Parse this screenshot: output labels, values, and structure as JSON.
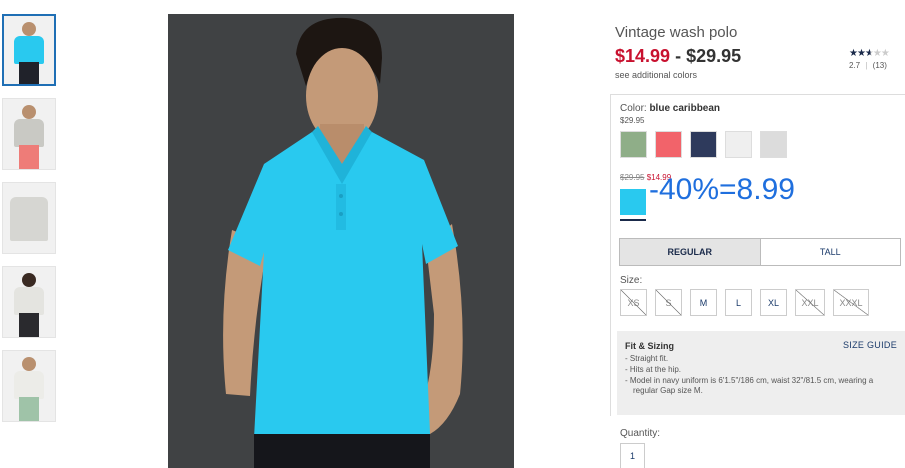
{
  "product": {
    "title": "Vintage wash polo",
    "price_sale": "$14.99",
    "price_separator": " - ",
    "price_regular": "$29.95",
    "see_additional_colors": "see additional colors",
    "rating_value": "2.7",
    "rating_count": "(13)",
    "rating_stars": 2.7
  },
  "color": {
    "label": "Color: ",
    "name": "blue caribbean",
    "price": "$29.95",
    "swatches": [
      {
        "name": "sage green",
        "color": "#8fae88"
      },
      {
        "name": "coral",
        "color": "#f2636a"
      },
      {
        "name": "navy",
        "color": "#2e3a5c"
      },
      {
        "name": "white",
        "color": "#efefef"
      },
      {
        "name": "light grey",
        "color": "#dcdcdc"
      }
    ],
    "selected_old_price": "$29.95",
    "selected_new_price": "$14.99",
    "selected_swatch_color": "#29c9ef"
  },
  "annotation": "-40%=8.99",
  "fit": {
    "options": [
      "REGULAR",
      "TALL"
    ],
    "selected": "REGULAR"
  },
  "size": {
    "label": "Size:",
    "options": [
      {
        "label": "XS",
        "available": false
      },
      {
        "label": "S",
        "available": false
      },
      {
        "label": "M",
        "available": true
      },
      {
        "label": "L",
        "available": true
      },
      {
        "label": "XL",
        "available": true
      },
      {
        "label": "XXL",
        "available": false
      },
      {
        "label": "XXXL",
        "available": false
      }
    ]
  },
  "fit_sizing": {
    "title": "Fit & Sizing",
    "guide_link": "SIZE GUIDE",
    "items": [
      "- Straight fit.",
      "- Hits at the hip.",
      "- Model in navy uniform is 6'1.5\"/186 cm, waist 32\"/81.5 cm, wearing a regular Gap size M."
    ]
  },
  "quantity": {
    "label": "Quantity:",
    "value": "1"
  },
  "colors": {
    "sale_red": "#c8102e",
    "link_navy": "#1a3a6a",
    "shirt_blue": "#29c9ef",
    "annotation_blue": "#1f6fde"
  }
}
